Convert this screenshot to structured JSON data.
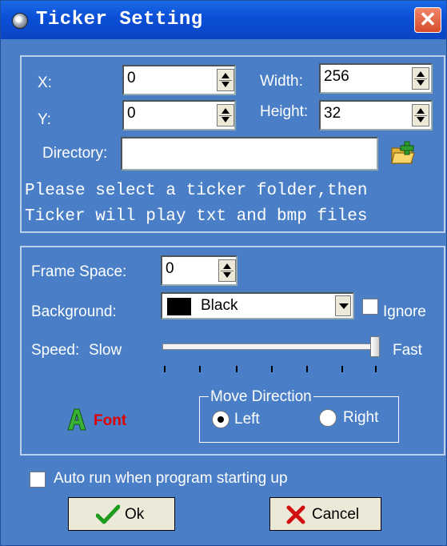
{
  "window": {
    "title": "Ticker Setting",
    "close_glyph": "✕"
  },
  "position": {
    "x_label": "X:",
    "x_value": "0",
    "y_label": "Y:",
    "y_value": "0",
    "width_label": "Width:",
    "width_value": "256",
    "height_label": "Height:",
    "height_value": "32",
    "directory_label": "Directory:",
    "directory_value": "",
    "hint_line1": "Please select a ticker folder,then",
    "hint_line2": "Ticker will play txt and bmp files"
  },
  "display": {
    "frame_space_label": "Frame Space:",
    "frame_space_value": "0",
    "background_label": "Background:",
    "background_value": "Black",
    "background_color": "#000000",
    "ignore_label": "Ignore",
    "ignore_checked": false,
    "speed_label": "Speed:",
    "speed_slow": "Slow",
    "speed_fast": "Fast",
    "speed_level": 1.0,
    "font_label": "Font",
    "move_direction_label": "Move Direction",
    "left_label": "Left",
    "right_label": "Right",
    "selected_direction": "Left"
  },
  "autorun_label": "Auto run when program starting up",
  "autorun_checked": false,
  "buttons": {
    "ok_label": "Ok",
    "cancel_label": "Cancel"
  },
  "icons": {
    "folder": "folder-add-icon",
    "font": "font-icon",
    "ok": "checkmark-icon",
    "cancel": "x-icon"
  },
  "colors": {
    "title_bar": "#0b4fd6",
    "dialog_bg": "#4a7fc8",
    "font_text": "#e00000",
    "close_button": "#d64b2a"
  }
}
